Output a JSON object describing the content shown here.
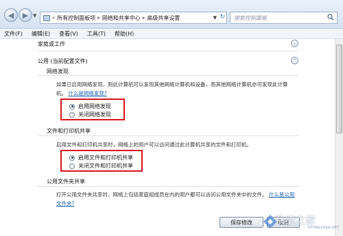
{
  "address_bar": {
    "breadcrumbs": [
      "所有控制面板项",
      "网络和共享中心",
      "高级共享设置"
    ],
    "search_placeholder": "搜索控制面板"
  },
  "menu": [
    "文件(F)",
    "编辑(E)",
    "查看(V)",
    "工具(T)",
    "帮助(H)"
  ],
  "sections": {
    "home_work": {
      "title": "家庭或工作"
    },
    "public": {
      "title": "公用 (当前配置文件)"
    }
  },
  "network_discovery": {
    "title": "网络发现",
    "description": "如果已启用网络发现，则此计算机可以发现其他网络计算机和设备，而其他网络计算机亦可发现此计算机。",
    "link": "什么是网络发现?",
    "options": [
      "启用网络发现",
      "关闭网络发现"
    ],
    "selected": 0
  },
  "file_printer_sharing": {
    "title": "文件和打印机共享",
    "description": "启用文件和打印机共享时，网络上的用户可以访问通过此计算机共享的文件和打印机。",
    "options": [
      "启用文件和打印机共享",
      "关闭文件和打印机共享"
    ],
    "selected": 0
  },
  "public_folder_sharing": {
    "title": "公用文件夹共享",
    "description": "打开公用文件夹共享时，网络上包括家庭组成员在内的用户都可以访问公用文件夹中的文件。",
    "link": "什么是公用文件夹?"
  },
  "buttons": {
    "save": "保存修改",
    "cancel": "取消"
  },
  "watermark": {
    "text": "系统之家",
    "url": "XITONGZHIJIA.NET"
  }
}
